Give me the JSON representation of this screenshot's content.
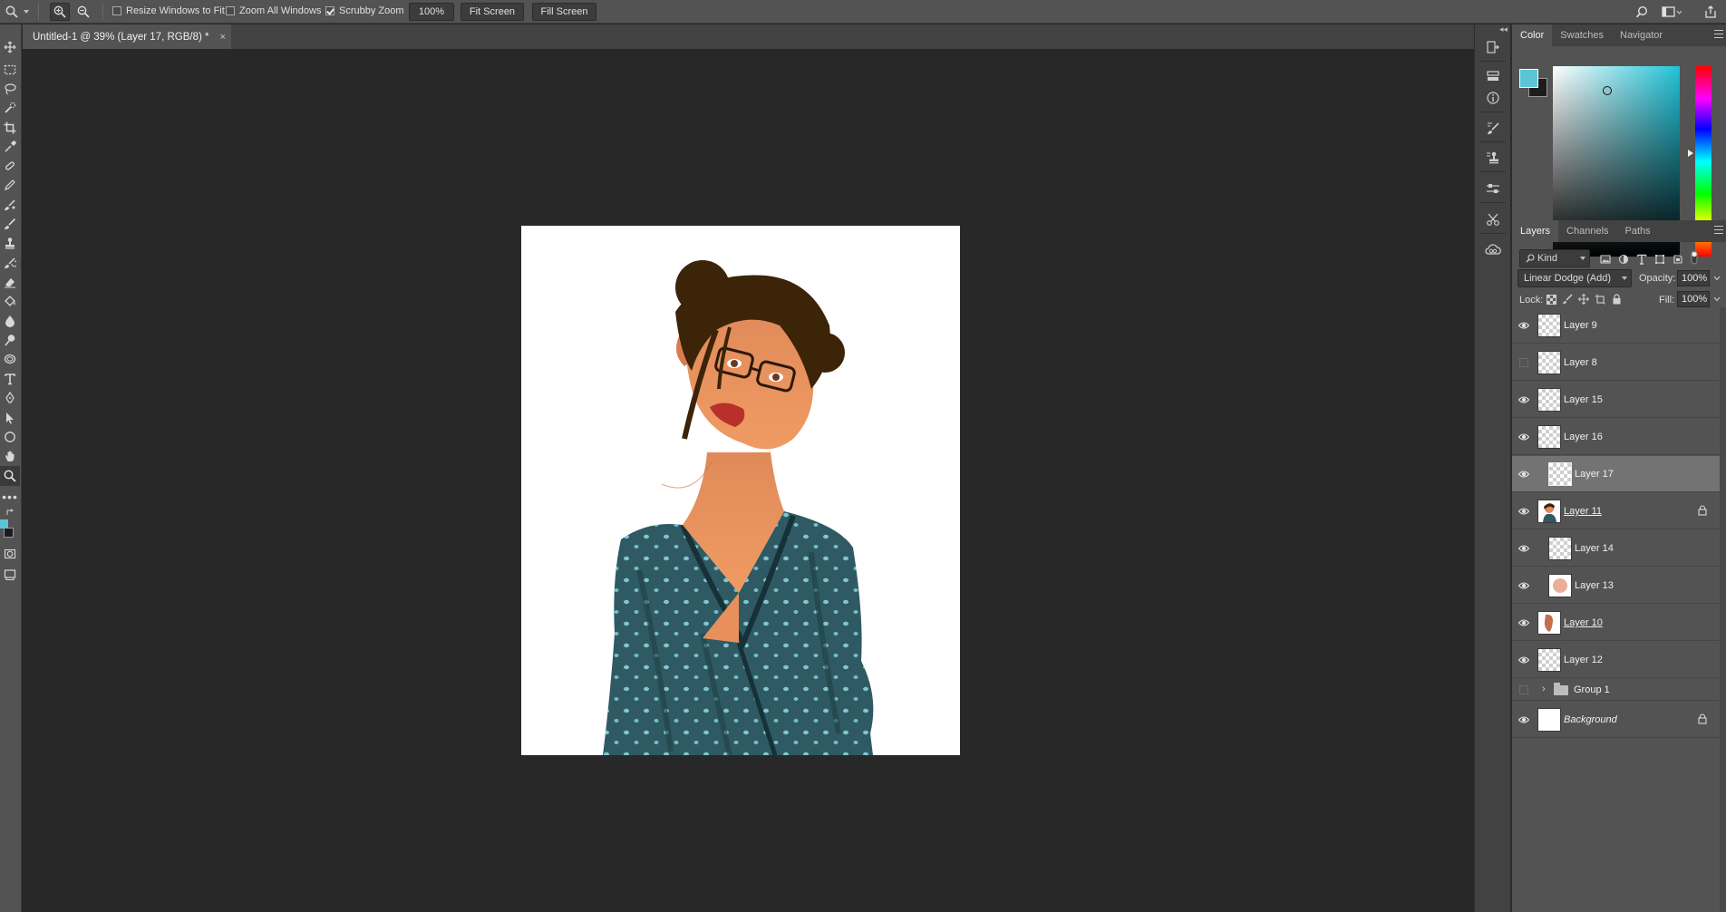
{
  "options_bar": {
    "resize_windows_label": "Resize Windows to Fit",
    "zoom_all_windows_label": "Zoom All Windows",
    "scrubby_zoom_label": "Scrubby Zoom",
    "zoom_percent": "100%",
    "fit_screen_label": "Fit Screen",
    "fill_screen_label": "Fill Screen",
    "resize_windows_checked": false,
    "zoom_all_windows_checked": false,
    "scrubby_zoom_checked": true
  },
  "document": {
    "tab_title": "Untitled-1 @ 39% (Layer 17, RGB/8) *",
    "close_glyph": "×"
  },
  "colors": {
    "foreground": "#5bc4d6",
    "background": "#1c1c1c",
    "accent_cyan": "#20c3d8"
  },
  "color_panel": {
    "tabs": [
      {
        "label": "Color",
        "active": true
      },
      {
        "label": "Swatches",
        "active": false
      },
      {
        "label": "Navigator",
        "active": false
      }
    ]
  },
  "layers_panel": {
    "tabs": [
      {
        "label": "Layers",
        "active": true
      },
      {
        "label": "Channels",
        "active": false
      },
      {
        "label": "Paths",
        "active": false
      }
    ],
    "filter_kind": "Kind",
    "blend_mode": "Linear Dodge (Add)",
    "opacity_label": "Opacity:",
    "opacity_value": "100%",
    "lock_label": "Lock:",
    "fill_label": "Fill:",
    "fill_value": "100%",
    "layers": [
      {
        "name": "Layer 9",
        "visible": true,
        "selected": false,
        "clipped": false,
        "smart": false,
        "locked": false
      },
      {
        "name": "Layer 8",
        "visible": false,
        "selected": false,
        "clipped": false,
        "smart": false,
        "locked": false
      },
      {
        "name": "Layer 15",
        "visible": true,
        "selected": false,
        "clipped": false,
        "smart": false,
        "locked": false
      },
      {
        "name": "Layer 16",
        "visible": true,
        "selected": false,
        "clipped": false,
        "smart": false,
        "locked": false
      },
      {
        "name": "Layer 17",
        "visible": true,
        "selected": true,
        "clipped": true,
        "smart": false,
        "locked": false
      },
      {
        "name": "Layer 11",
        "visible": true,
        "selected": false,
        "clipped": false,
        "smart": true,
        "locked": true
      },
      {
        "name": "Layer 14",
        "visible": true,
        "selected": false,
        "clipped": true,
        "smart": false,
        "locked": false
      },
      {
        "name": "Layer 13",
        "visible": true,
        "selected": false,
        "clipped": true,
        "smart": false,
        "locked": false
      },
      {
        "name": "Layer 10",
        "visible": true,
        "selected": false,
        "clipped": false,
        "smart": true,
        "locked": false
      },
      {
        "name": "Layer 12",
        "visible": true,
        "selected": false,
        "clipped": false,
        "smart": false,
        "locked": false
      }
    ],
    "group": {
      "name": "Group 1",
      "visible": false,
      "chevron": "›"
    },
    "background_layer": {
      "name": "Background",
      "visible": true,
      "locked": true
    }
  },
  "icons": {
    "panel_collapse": "◂◂"
  }
}
